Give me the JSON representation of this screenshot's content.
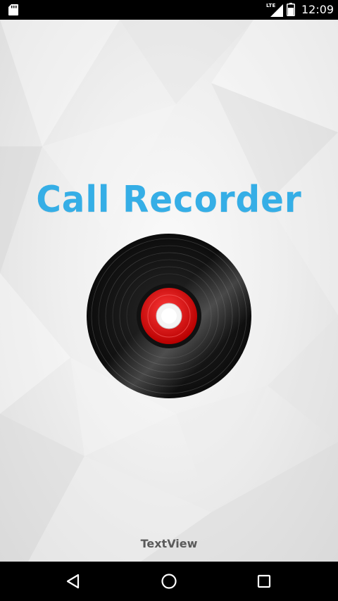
{
  "status_bar": {
    "network_label": "LTE",
    "time": "12:09",
    "icons": [
      "sd-card-icon",
      "signal-icon",
      "battery-icon"
    ]
  },
  "app": {
    "title": "Call Recorder",
    "title_color": "#35aee6",
    "bottom_text": "TextView"
  },
  "nav_bar": {
    "buttons": [
      "back-icon",
      "home-icon",
      "recents-icon"
    ]
  }
}
